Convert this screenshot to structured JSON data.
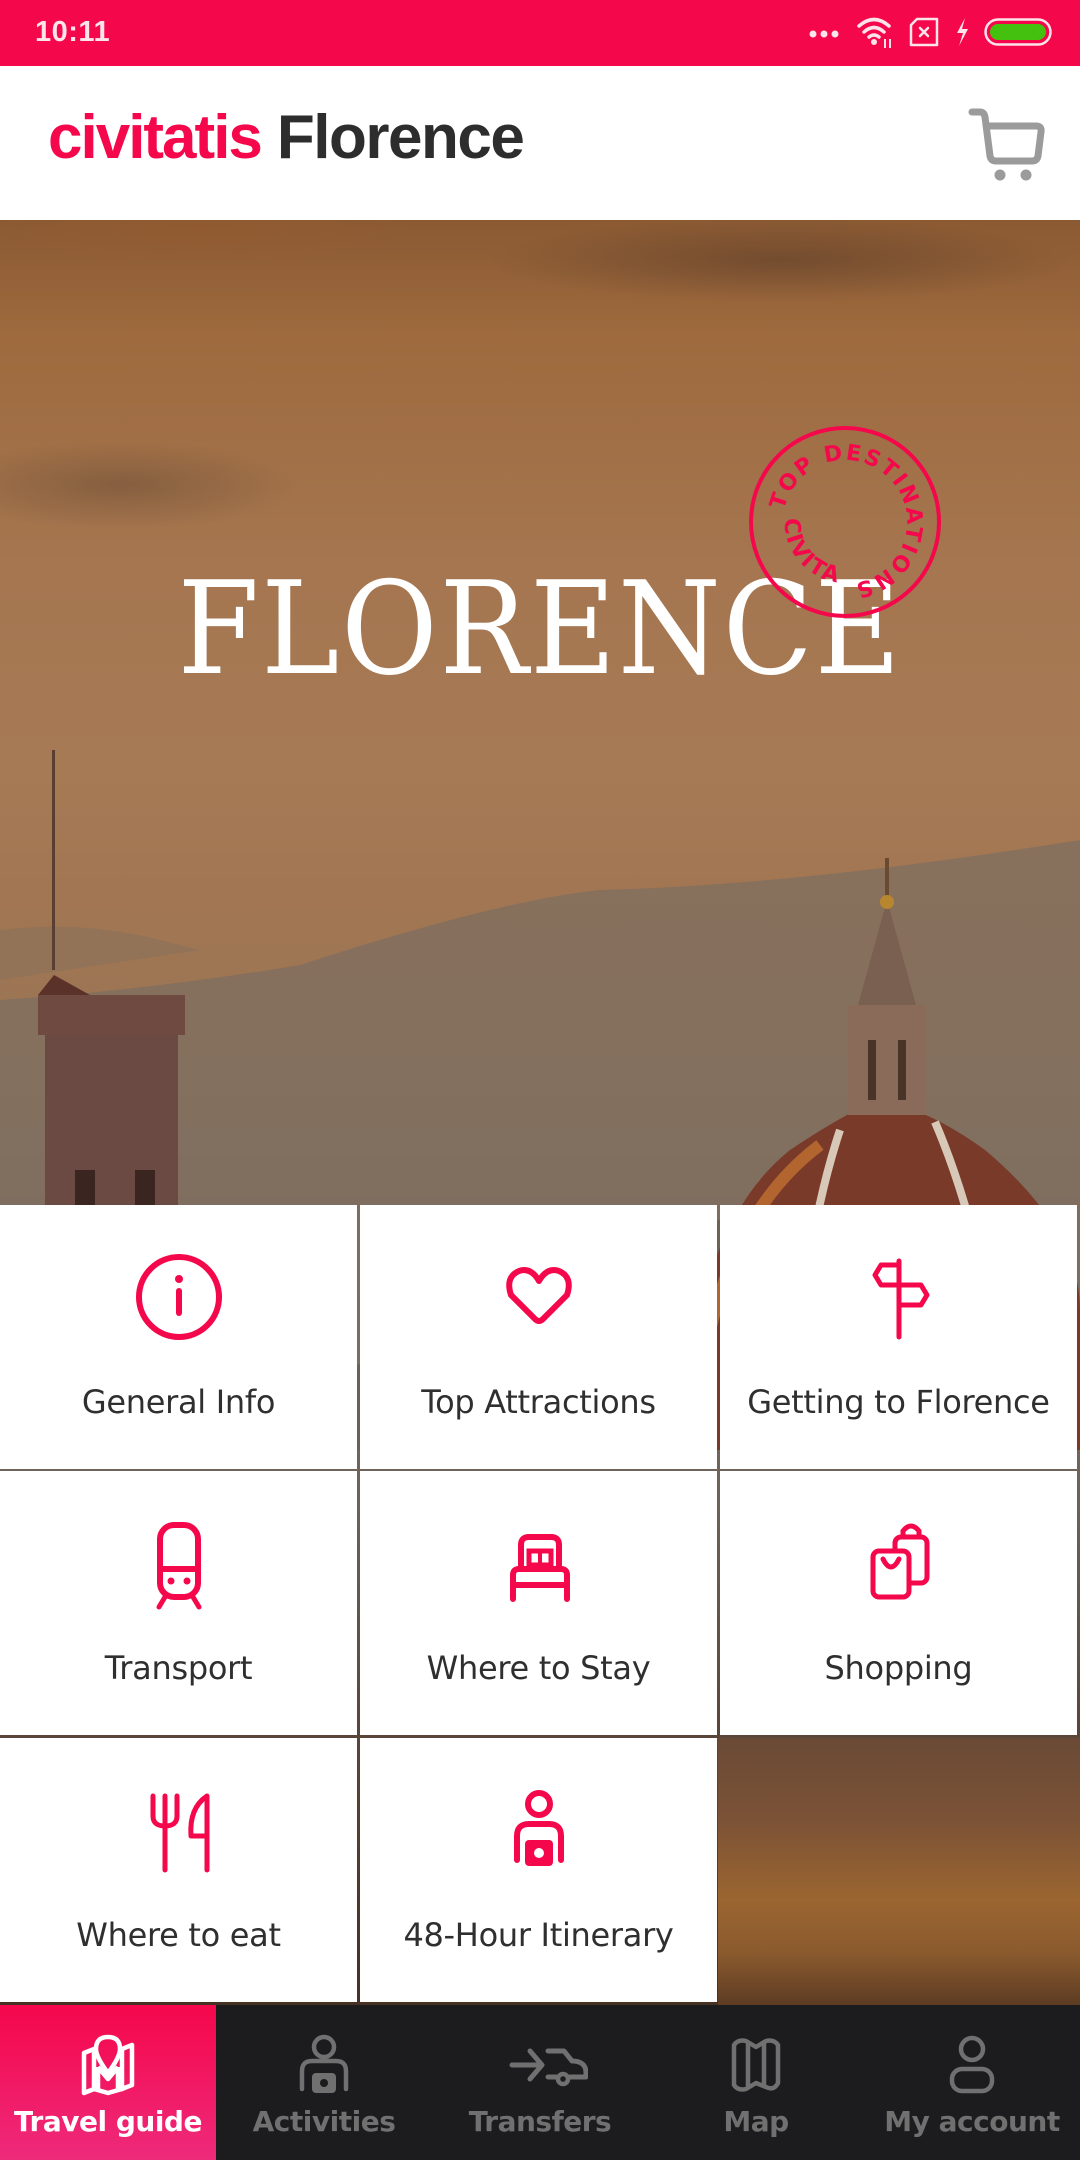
{
  "status_bar": {
    "time": "10:11",
    "icons": [
      "more-dots-icon",
      "wifi-icon",
      "no-sim-icon",
      "charging-icon",
      "battery-icon"
    ],
    "battery_level": 1.0,
    "battery_color": "#44c10e"
  },
  "header": {
    "brand": "civitatis",
    "city": "Florence",
    "cart_icon": "cart-icon"
  },
  "hero": {
    "title": "FLORENCE",
    "badge_top_text": "TOP DESTINATIONS",
    "badge_bottom_text": "CIVITATIS"
  },
  "colors": {
    "accent": "#f5074b",
    "nav_background": "#1c1b1d",
    "nav_inactive": "#707070",
    "tile_text": "#2f2f2f"
  },
  "menu": {
    "tiles": [
      {
        "label": "General Info",
        "icon": "info-icon"
      },
      {
        "label": "Top Attractions",
        "icon": "heart-icon"
      },
      {
        "label": "Getting to Florence",
        "icon": "signpost-icon"
      },
      {
        "label": "Transport",
        "icon": "train-icon"
      },
      {
        "label": "Where to Stay",
        "icon": "bed-icon"
      },
      {
        "label": "Shopping",
        "icon": "shopping-bags-icon"
      },
      {
        "label": "Where to eat",
        "icon": "fork-knife-icon"
      },
      {
        "label": "48-Hour Itinerary",
        "icon": "tourist-camera-icon"
      }
    ]
  },
  "bottom_nav": {
    "active_index": 0,
    "items": [
      {
        "label": "Travel guide",
        "icon": "map-pin-icon"
      },
      {
        "label": "Activities",
        "icon": "tourist-camera-icon"
      },
      {
        "label": "Transfers",
        "icon": "transfer-car-icon"
      },
      {
        "label": "Map",
        "icon": "map-icon"
      },
      {
        "label": "My account",
        "icon": "user-icon"
      }
    ]
  }
}
